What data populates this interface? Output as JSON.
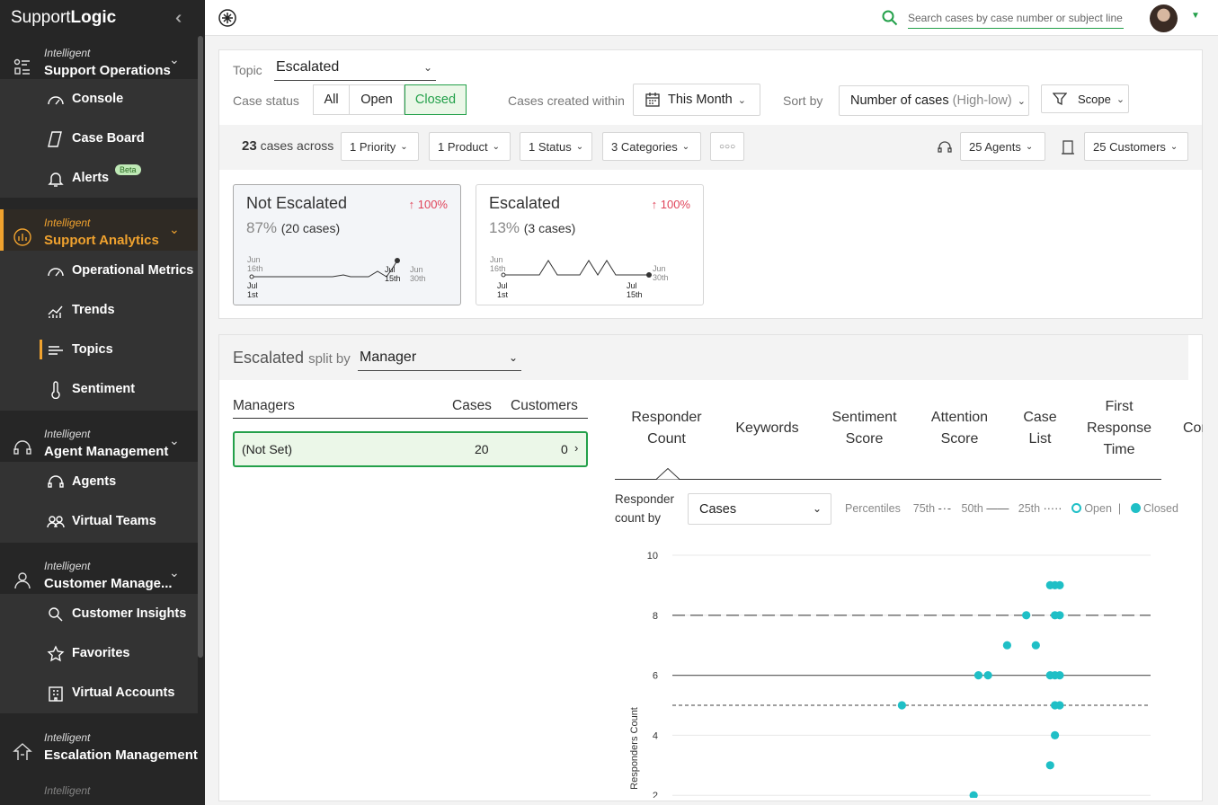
{
  "app": {
    "brand_a": "Support",
    "brand_b": "Logic"
  },
  "sidebar": {
    "groups": [
      {
        "small": "Intelligent",
        "label": "Support Operations"
      },
      {
        "small": "Intelligent",
        "label": "Support Analytics"
      },
      {
        "small": "Intelligent",
        "label": "Agent Management"
      },
      {
        "small": "Intelligent",
        "label": "Customer Manage..."
      },
      {
        "small": "Intelligent",
        "label": "Escalation Management"
      },
      {
        "small": "Intelligent",
        "label": ""
      }
    ],
    "items": {
      "console": "Console",
      "case_board": "Case Board",
      "alerts": "Alerts",
      "beta": "Beta",
      "operational_metrics": "Operational Metrics",
      "trends": "Trends",
      "topics": "Topics",
      "sentiment": "Sentiment",
      "agents": "Agents",
      "virtual_teams": "Virtual Teams",
      "customer_insights": "Customer Insights",
      "favorites": "Favorites",
      "virtual_accounts": "Virtual Accounts"
    }
  },
  "topbar": {
    "search_placeholder": "Search cases by case number or subject line"
  },
  "filters": {
    "topic_label": "Topic",
    "topic_value": "Escalated",
    "case_status_label": "Case status",
    "status_all": "All",
    "status_open": "Open",
    "status_closed": "Closed",
    "created_label": "Cases created within",
    "created_value": "This Month",
    "sort_label": "Sort by",
    "sort_value": "Number of cases",
    "sort_hint": "(High-low)",
    "scope": "Scope",
    "count": "23",
    "count_suffix": "cases across",
    "priority": "1 Priority",
    "product": "1 Product",
    "status": "1 Status",
    "categories": "3 Categories",
    "more": "○○○",
    "agents": "25 Agents",
    "customers": "25 Customers"
  },
  "cards": [
    {
      "title": "Not Escalated",
      "change": "↑ 100%",
      "share": "87%",
      "cases": "(20 cases)"
    },
    {
      "title": "Escalated",
      "change": "↑ 100%",
      "share": "13%",
      "cases": "(3 cases)"
    }
  ],
  "spark_labels": {
    "jun": "Jun",
    "jul": "Jul",
    "d16": "16th",
    "d1": "1st",
    "d15": "15th",
    "d30": "30th"
  },
  "split": {
    "title": "Escalated",
    "by": "split by",
    "value": "Manager",
    "col_managers": "Managers",
    "col_cases": "Cases",
    "col_customers": "Customers",
    "row": {
      "name": "(Not Set)",
      "cases": "20",
      "customers": "0"
    }
  },
  "tabs": [
    {
      "l1": "Responder",
      "l2": "Count"
    },
    {
      "l1": "Keywords",
      "l2": ""
    },
    {
      "l1": "Sentiment",
      "l2": "Score"
    },
    {
      "l1": "Attention",
      "l2": "Score"
    },
    {
      "l1": "Case",
      "l2": "List"
    },
    {
      "l1": "First",
      "l2": "Response",
      "l3": "Time"
    },
    {
      "l1": "Conv",
      "l2": ""
    }
  ],
  "responder": {
    "by_l1": "Responder",
    "by_l2": "count by",
    "select": "Cases",
    "percentiles": "Percentiles",
    "p75": "75th",
    "p50": "50th",
    "p25": "25th",
    "open": "Open",
    "closed": "Closed"
  },
  "chart_data": {
    "type": "scatter",
    "ylabel": "Responders Count",
    "yticks": [
      2,
      4,
      6,
      8,
      10
    ],
    "ylim": [
      2,
      10
    ],
    "percentile_lines": {
      "p75": 8,
      "p50": 6,
      "p25": 5
    },
    "series": [
      {
        "name": "Closed",
        "color": "#1fbfc6",
        "points": [
          [
            0.48,
            5
          ],
          [
            0.63,
            2
          ],
          [
            0.64,
            6
          ],
          [
            0.66,
            6
          ],
          [
            0.7,
            7
          ],
          [
            0.76,
            7
          ],
          [
            0.74,
            8
          ],
          [
            0.79,
            9
          ],
          [
            0.8,
            9
          ],
          [
            0.81,
            9
          ],
          [
            0.8,
            8
          ],
          [
            0.81,
            8
          ],
          [
            0.79,
            6
          ],
          [
            0.8,
            6
          ],
          [
            0.81,
            6
          ],
          [
            0.8,
            5
          ],
          [
            0.81,
            5
          ],
          [
            0.8,
            4
          ],
          [
            0.79,
            3
          ]
        ]
      }
    ]
  },
  "colors": {
    "accent": "#23a04a",
    "orange": "#f0a22e",
    "teal": "#1fbfc6",
    "red": "#e0445a"
  }
}
